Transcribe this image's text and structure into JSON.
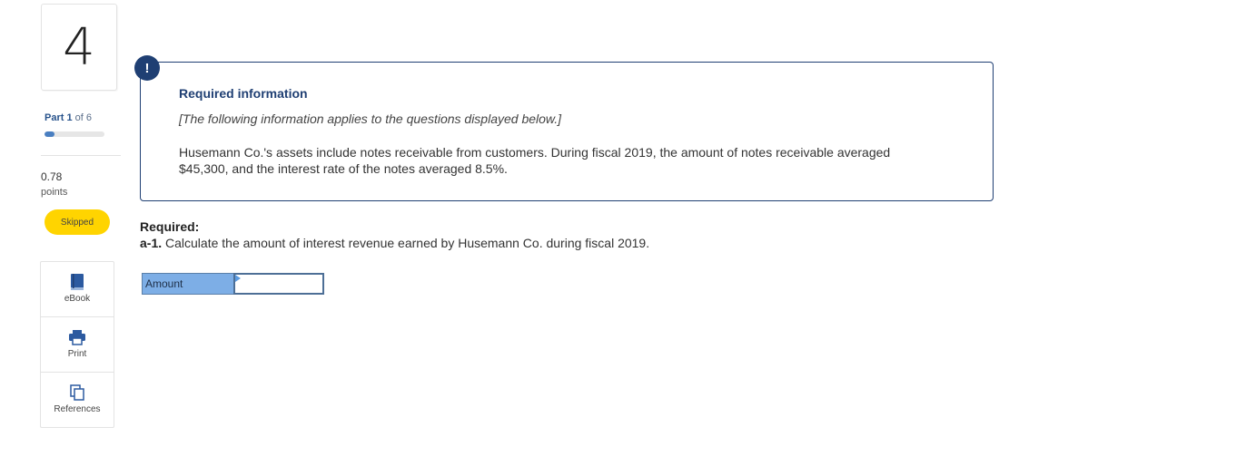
{
  "sidebar": {
    "question_number": "4",
    "part": {
      "prefix": "Part",
      "current": "1",
      "suffix": "of 6"
    },
    "progress_fraction": 0.1667,
    "points_value": "0.78",
    "points_label": "points",
    "status": "Skipped",
    "tools": [
      {
        "label": "eBook",
        "icon": "book-icon"
      },
      {
        "label": "Print",
        "icon": "printer-icon"
      },
      {
        "label": "References",
        "icon": "copy-icon"
      }
    ]
  },
  "info": {
    "badge": "!",
    "title": "Required information",
    "note": "[The following information applies to the questions displayed below.]",
    "body": "Husemann Co.'s assets include notes receivable from customers. During fiscal 2019, the amount of notes receivable averaged $45,300, and the interest rate of the notes averaged 8.5%."
  },
  "required": {
    "heading": "Required:",
    "item_label": "a-1.",
    "item_text": " Calculate the amount of interest revenue earned by Husemann Co. during fiscal 2019."
  },
  "answer": {
    "row_label": "Amount",
    "value": ""
  },
  "colors": {
    "navy": "#1f3f73",
    "badge_yellow": "#ffd400",
    "input_header_blue": "#7daee6",
    "progress_blue": "#4a7fc1"
  }
}
